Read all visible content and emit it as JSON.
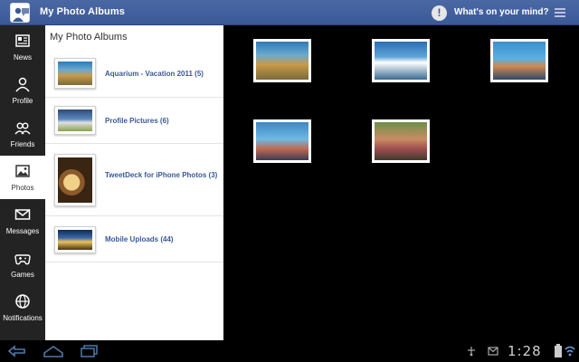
{
  "header": {
    "title": "My Photo Albums",
    "status_prompt": "What's on your mind?"
  },
  "sidebar": {
    "items": [
      {
        "label": "News",
        "icon": "news-icon",
        "active": false
      },
      {
        "label": "Profile",
        "icon": "profile-icon",
        "active": false
      },
      {
        "label": "Friends",
        "icon": "friends-icon",
        "active": false
      },
      {
        "label": "Photos",
        "icon": "photos-icon",
        "active": true
      },
      {
        "label": "Messages",
        "icon": "messages-icon",
        "active": false
      },
      {
        "label": "Games",
        "icon": "games-icon",
        "active": false
      },
      {
        "label": "Notifications",
        "icon": "globe-icon",
        "active": false
      }
    ]
  },
  "albums": {
    "title": "My Photo Albums",
    "items": [
      {
        "label": "Aquarium - Vacation 2011 (5)"
      },
      {
        "label": "Profile Pictures (6)"
      },
      {
        "label": "TweetDeck for iPhone Photos (3)"
      },
      {
        "label": "Mobile Uploads (44)"
      }
    ]
  },
  "photos": {
    "count": 5
  },
  "system_bar": {
    "clock": "1:28"
  },
  "colors": {
    "brand": "#3b5998",
    "sidebar_bg": "#232323",
    "link": "#3b5998"
  }
}
